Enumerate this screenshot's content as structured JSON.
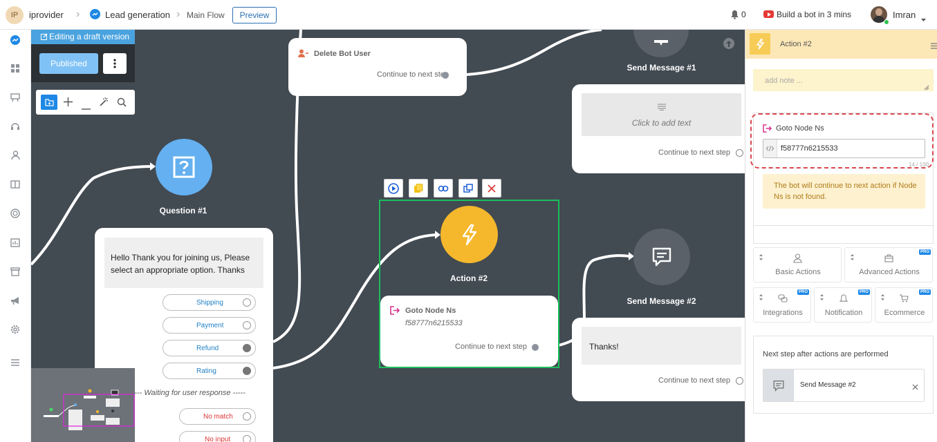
{
  "header": {
    "avatar_initials": "IP",
    "workspace": "iprovider",
    "chevron1": "›",
    "bot_name": "Lead generation",
    "chevron2": "›",
    "flow_name": "Main Flow",
    "preview_label": "Preview",
    "notif_count": "0",
    "promo_text": "Build a bot in 3 mins",
    "user_name": "Imran"
  },
  "editor": {
    "draft_label": "Editing a draft version",
    "published_label": "Published"
  },
  "nodes": {
    "delete_bot_user": {
      "title": "Delete Bot User",
      "continue": "Continue to next step"
    },
    "send_message_1": {
      "title": "Send Message #1",
      "placeholder": "Click to add text",
      "continue": "Continue to next step"
    },
    "question_1": {
      "title": "Question #1",
      "text": "Hello  Thank you for joining us, Please select an appropriate option. Thanks",
      "options": [
        "Shipping",
        "Payment",
        "Refund",
        "Rating"
      ],
      "waiting": "----- Waiting for user response -----",
      "no_match": "No match",
      "no_input": "No input"
    },
    "action_2": {
      "title": "Action #2",
      "goto_title": "Goto Node Ns",
      "node_id": "f58777n6215533",
      "continue": "Continue to next step"
    },
    "send_message_2": {
      "title": "Send Message #2",
      "text": "Thanks!",
      "continue": "Continue to next step"
    }
  },
  "panel": {
    "title": "Action #2",
    "note_placeholder": "add note ...",
    "goto_title": "Goto Node Ns",
    "goto_value": "f58777n6215533",
    "counter": "14 / 100",
    "info": "The bot will continue to next action if Node Ns is not found.",
    "actions": [
      {
        "label": "Basic Actions",
        "pro": ""
      },
      {
        "label": "Advanced Actions",
        "pro": "PRO"
      },
      {
        "label": "Integrations",
        "pro": "PRO"
      },
      {
        "label": "Notification",
        "pro": "PRO"
      },
      {
        "label": "Ecommerce",
        "pro": "PRO"
      }
    ],
    "next_step_label": "Next step after actions are performed",
    "next_step_value": "Send Message #2"
  },
  "colors": {
    "accent_blue": "#2a6fb2",
    "action_yellow": "#f5b72b",
    "question_blue": "#64b0f0",
    "selected_green": "#1bbf5c",
    "goto_pink": "#d6328e",
    "canvas_bg": "#424a52"
  }
}
